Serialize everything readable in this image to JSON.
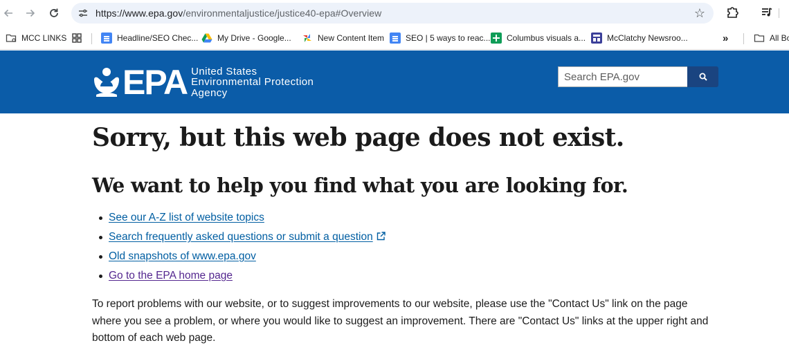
{
  "browser": {
    "url_host": "https://www.epa.gov",
    "url_path": "/environmentaljustice/justice40-epa#Overview",
    "bookmarks": [
      {
        "label": "MCC LINKS",
        "icon": "folder-icon"
      },
      {
        "label": "Headline/SEO Chec...",
        "icon": "docs-icon"
      },
      {
        "label": "My Drive - Google...",
        "icon": "drive-icon"
      },
      {
        "label": "New Content Item",
        "icon": "pinwheel-icon"
      },
      {
        "label": "SEO | 5 ways to reac...",
        "icon": "docs-icon"
      },
      {
        "label": "Columbus visuals a...",
        "icon": "sheets-plus-icon"
      },
      {
        "label": "McClatchy Newsroo...",
        "icon": "forms-icon"
      },
      {
        "label": "All Bo",
        "icon": "folder-icon"
      }
    ]
  },
  "header": {
    "logo_letters": "EPA",
    "agency_line1": "United States",
    "agency_line2": "Environmental Protection",
    "agency_line3": "Agency",
    "search_placeholder": "Search EPA.gov",
    "brand_color": "#0b5ca8"
  },
  "main": {
    "title": "Sorry, but this web page does not exist.",
    "subtitle": "We want to help you find what you are looking for.",
    "links": [
      {
        "label": "See our A-Z list of website topics"
      },
      {
        "label": "Search frequently asked questions or submit a question"
      },
      {
        "label": "Old snapshots of www.epa.gov"
      },
      {
        "label": "Go to the EPA home page"
      }
    ],
    "report_text": "To report problems with our website, or to suggest improvements to our website, please use the \"Contact Us\" link on the page where you see a problem, or where you would like to suggest an improvement. There are \"Contact Us\" links at the upper right and bottom of each web page."
  }
}
